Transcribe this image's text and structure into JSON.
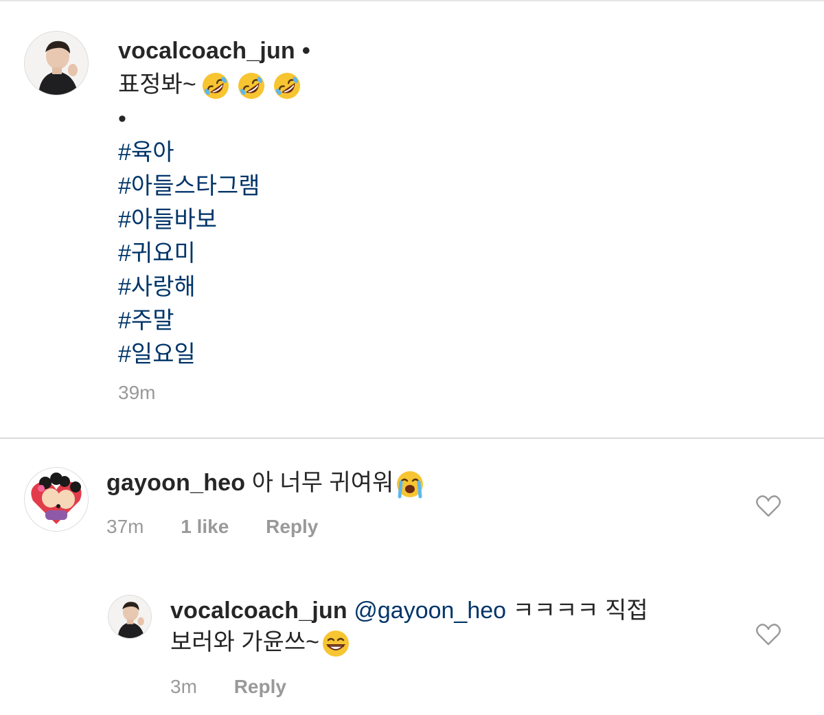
{
  "post": {
    "username": "vocalcoach_jun",
    "separator": "•",
    "caption_text": "표정봐~",
    "caption_emoji_count": 3,
    "bullet": "•",
    "hashtags": [
      "#육아",
      "#아들스타그램",
      "#아들바보",
      "#귀요미",
      "#사랑해",
      "#주말",
      "#일요일"
    ],
    "time": "39m"
  },
  "comments": [
    {
      "username": "gayoon_heo",
      "text": "아 너무 귀여워",
      "emoji": "loudly-crying-face",
      "time": "37m",
      "likes": "1 like",
      "reply_label": "Reply"
    }
  ],
  "reply": {
    "username": "vocalcoach_jun",
    "mention": "@gayoon_heo",
    "text_line1": "ㅋㅋㅋㅋ 직접",
    "text_line2": "보러와 가윤쓰~",
    "emoji": "grinning-face",
    "time": "3m",
    "reply_label": "Reply"
  },
  "colors": {
    "hashtag": "#003569",
    "meta": "#999999",
    "divider": "#dbdbdb",
    "heart": "#999999"
  }
}
